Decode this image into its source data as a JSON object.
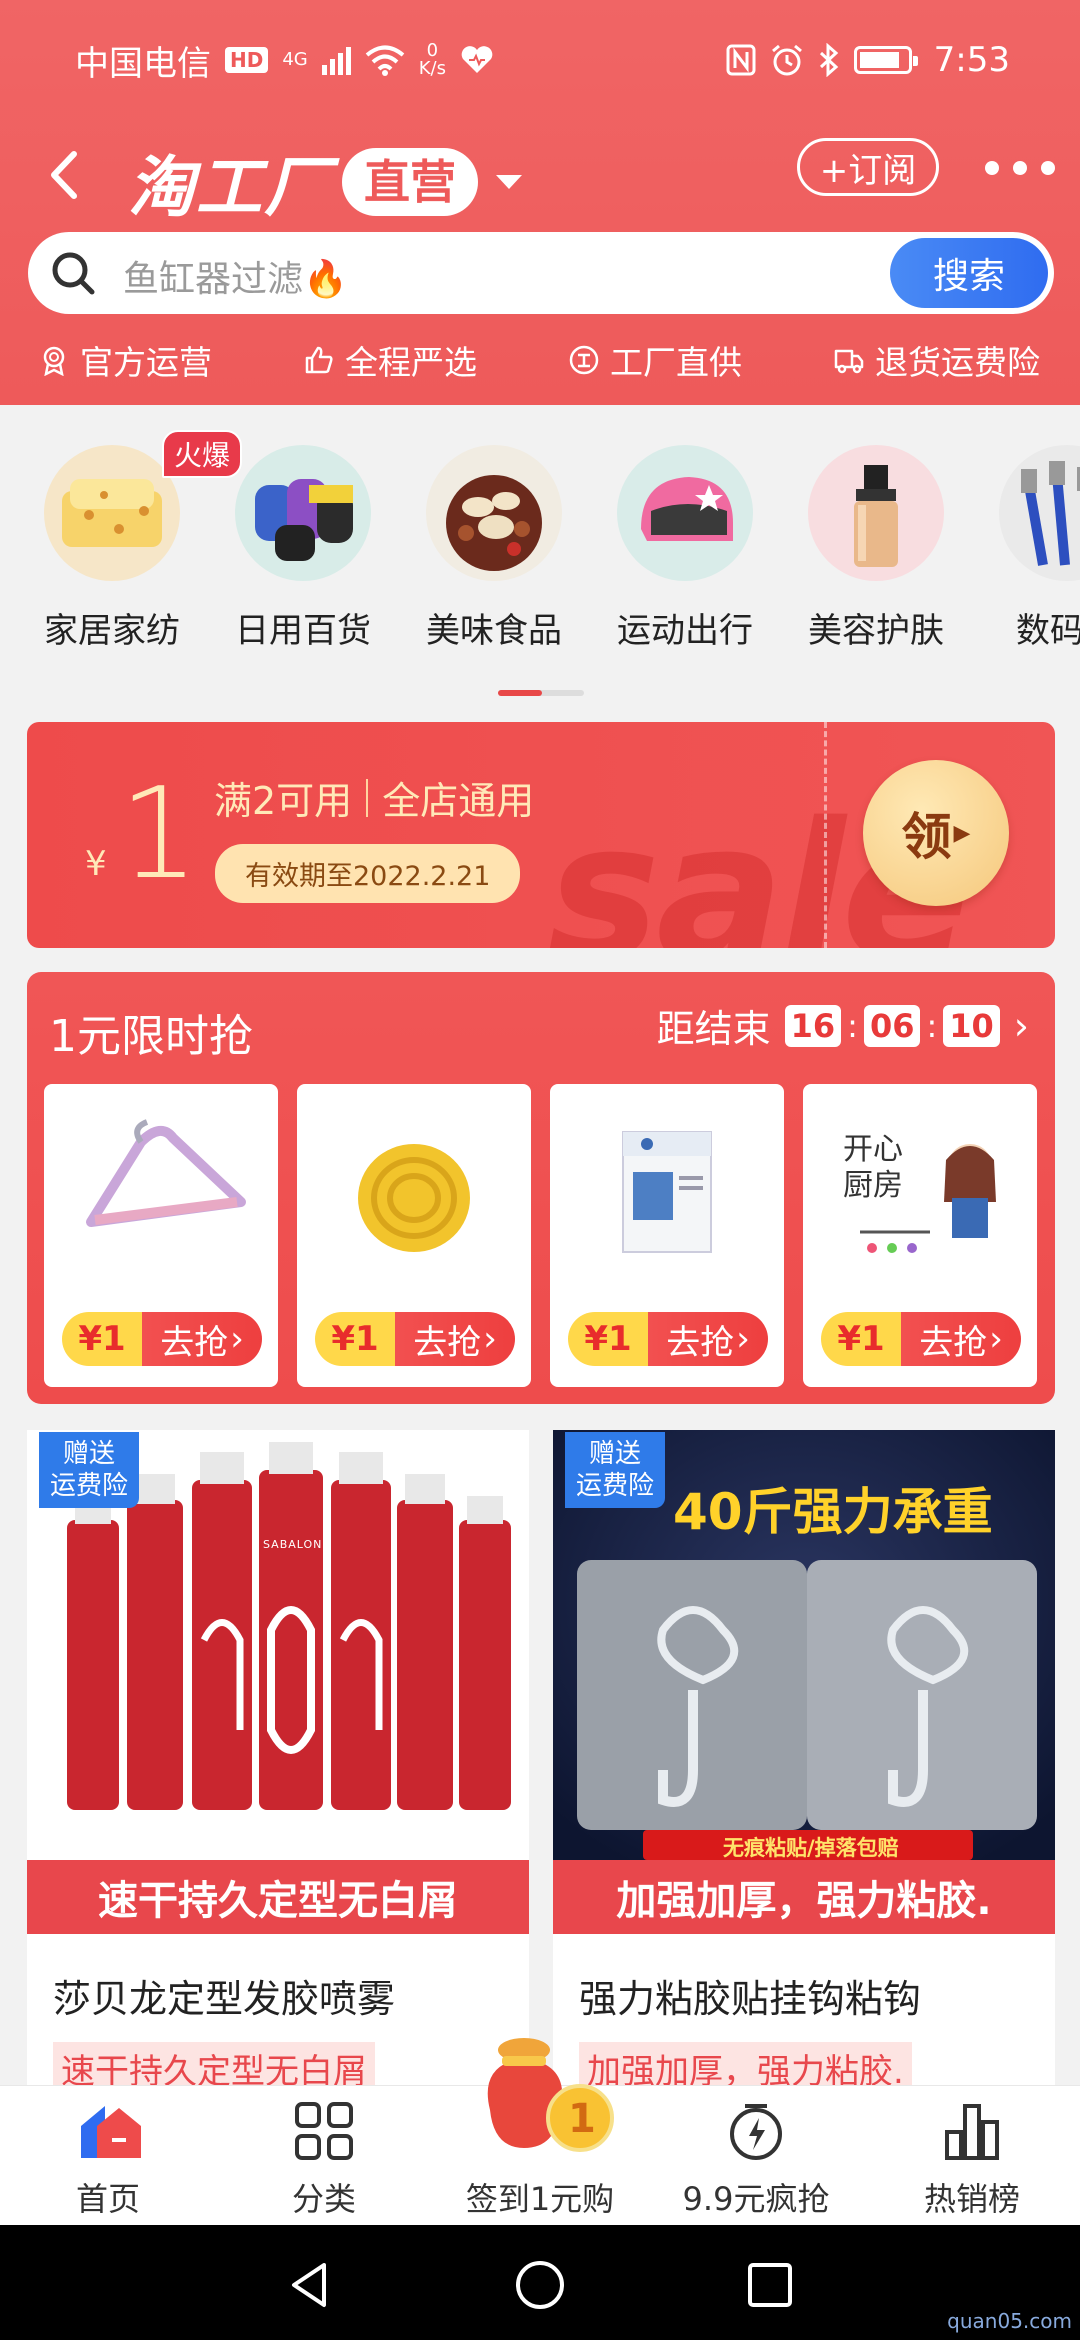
{
  "status_bar": {
    "carrier": "中国电信",
    "hd": "HD",
    "net": "4G",
    "speed_value": "0",
    "speed_unit": "K/s",
    "time": "7:53"
  },
  "header": {
    "brand_name": "淘工厂",
    "brand_tag": "直营",
    "subscribe_label": "+订阅"
  },
  "search": {
    "placeholder": "鱼缸器过滤🔥",
    "button_label": "搜索"
  },
  "features": [
    {
      "label": "官方运营",
      "icon": "ribbon-icon"
    },
    {
      "label": "全程严选",
      "icon": "thumbs-up-icon"
    },
    {
      "label": "工厂直供",
      "icon": "factory-icon"
    },
    {
      "label": "退货运费险",
      "icon": "truck-icon"
    }
  ],
  "categories": [
    {
      "label": "家居家纺",
      "badge": "火爆"
    },
    {
      "label": "日用百货"
    },
    {
      "label": "美味食品"
    },
    {
      "label": "运动出行"
    },
    {
      "label": "美容护肤"
    },
    {
      "label": "数码电"
    }
  ],
  "coupon": {
    "currency": "¥",
    "amount": "1",
    "condition": "满2可用",
    "scope": "全店通用",
    "expiry": "有效期至2022.2.21",
    "claim_label": "领",
    "watermark": "sale"
  },
  "flash_sale": {
    "title": "1元限时抢",
    "countdown_label": "距结束",
    "hours": "16",
    "minutes": "06",
    "seconds": "10",
    "items": [
      {
        "price": "¥1",
        "action": "去抢"
      },
      {
        "price": "¥1",
        "action": "去抢"
      },
      {
        "price": "¥1",
        "action": "去抢"
      },
      {
        "price": "¥1",
        "action": "去抢"
      }
    ],
    "item4_caption": "开心厨房"
  },
  "products": [
    {
      "ship_badge": "赠送\n运费险",
      "banner": "速干持久定型无白屑",
      "title": "莎贝龙定型发胶喷雾",
      "subtitle": "速干持久定型无白屑",
      "brand_print": "SABALON"
    },
    {
      "ship_badge": "赠送\n运费险",
      "headline": "40斤强力承重",
      "strip": "无痕粘贴/掉落包赔",
      "banner": "加强加厚，强力粘胶.",
      "title": "强力粘胶贴挂钩粘钩",
      "subtitle": "加强加厚，强力粘胶."
    }
  ],
  "tabbar": [
    {
      "label": "首页",
      "icon": "home-icon"
    },
    {
      "label": "分类",
      "icon": "grid-icon"
    },
    {
      "label": "签到1元购",
      "icon": "lucky-bag-icon"
    },
    {
      "label": "9.9元疯抢",
      "icon": "lightning-clock-icon"
    },
    {
      "label": "热销榜",
      "icon": "bar-chart-icon"
    }
  ],
  "signin_coin": "1",
  "watermark_site": "quan05.com",
  "colors": {
    "header_red": "#ee5a5a",
    "search_blue": "#2f6cf0",
    "coupon_gold": "#ffe3b0",
    "price_yellow": "#ffd84a"
  }
}
